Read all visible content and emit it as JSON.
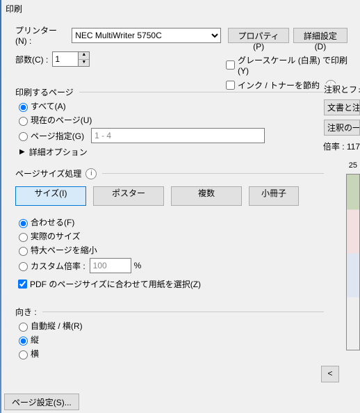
{
  "title": "印刷",
  "printer": {
    "label": "プリンター(N) :",
    "value": "NEC MultiWriter 5750C",
    "properties_btn": "プロパティ(P)",
    "advanced_btn": "詳細設定(D)"
  },
  "copies": {
    "label": "部数(C) :",
    "value": "1"
  },
  "options": {
    "grayscale": "グレースケール (白黒) で印刷(Y)",
    "save_ink": "インク / トナーを節約"
  },
  "pages": {
    "group": "印刷するページ",
    "all": "すべて(A)",
    "current": "現在のページ(U)",
    "range": "ページ指定(G)",
    "range_value": "1 - 4",
    "advanced": "詳細オプション"
  },
  "sizing": {
    "group": "ページサイズ処理",
    "tabs": {
      "size": "サイズ(I)",
      "poster": "ポスター",
      "multi": "複数",
      "booklet": "小冊子"
    },
    "fit": "合わせる(F)",
    "actual": "実際のサイズ",
    "shrink": "特大ページを縮小",
    "custom": "カスタム倍率 :",
    "custom_value": "100",
    "percent": "%",
    "choose_paper": "PDF のページサイズに合わせて用紙を選択(Z)"
  },
  "orientation": {
    "group": "向き :",
    "auto": "自動縦 / 横(R)",
    "portrait": "縦",
    "landscape": "横"
  },
  "right": {
    "annotations": "注釈とフォ",
    "doc_annot": "文書と注",
    "annot_opt": "注釈の一",
    "zoom": "倍率 : 117",
    "count": "25",
    "prev": "<"
  },
  "bottom": {
    "page_setup": "ページ設定(S)..."
  }
}
